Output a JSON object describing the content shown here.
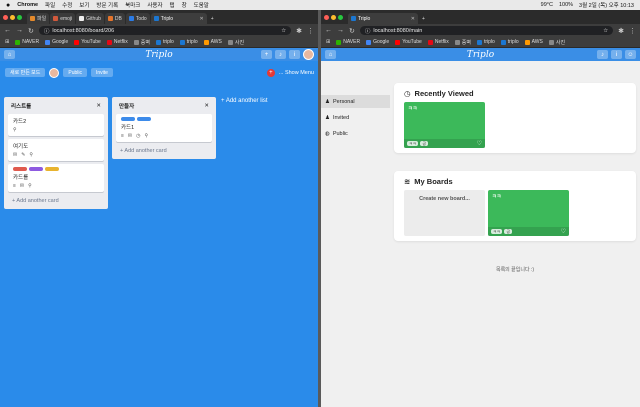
{
  "menubar": {
    "app": "Chrome",
    "items": [
      "파일",
      "수정",
      "보기",
      "방문 기록",
      "북마크",
      "사용자",
      "탭",
      "창",
      "도움말"
    ],
    "right": [
      "99°C",
      "100%",
      "3월 2일 (목) 오후 10:13"
    ]
  },
  "left": {
    "tabs": [
      "파일",
      "emoji",
      "Github",
      "DB",
      "Todo",
      "Triplo"
    ],
    "active_tab": "Triplo",
    "url": "localhost:8080/board/206",
    "bookmarks": [
      "NAVER",
      "Google",
      "YouTube",
      "Netflix",
      "증벽",
      "triplo",
      "triplo",
      "AWS",
      "사진"
    ],
    "app_logo": "Triplo",
    "board": {
      "title_chip": "새로 만든 보드",
      "public_chip": "Public",
      "invite_chip": "Invite",
      "badge": "+",
      "show_menu": "... Show Menu",
      "add_list": "+ Add another list",
      "lists": [
        {
          "title": "리스트를",
          "close": "✕",
          "cards": [
            {
              "title": "카드2",
              "labels": [],
              "badges": [
                "⚲"
              ]
            },
            {
              "title": "여기도",
              "labels": [],
              "badges": [
                "✉",
                "✎",
                "⚲"
              ]
            },
            {
              "title": "카드를",
              "labels": [
                "#e05a4e",
                "#8e5ae0",
                "#e8b32e"
              ],
              "badges": [
                "≡",
                "✉",
                "⚲"
              ]
            }
          ],
          "add_card": "+ Add another card"
        },
        {
          "title": "만들자",
          "close": "✕",
          "cards": [
            {
              "title": "카드1",
              "labels": [
                "#3d8bea",
                "#3d8bea"
              ],
              "badges": [
                "≡",
                "✉",
                "◷",
                "⚲"
              ]
            }
          ],
          "add_card": "+ Add another card"
        }
      ]
    }
  },
  "right": {
    "tab": "Triplo",
    "url": "localhost:8080/main",
    "bookmarks": [
      "NAVER",
      "Google",
      "YouTube",
      "Netflix",
      "증벽",
      "triplo",
      "triplo",
      "AWS",
      "사진"
    ],
    "app_logo": "Triplo",
    "sidebar": [
      "Personal",
      "Invited",
      "Public"
    ],
    "recently_viewed": {
      "title": "Recently Viewed",
      "tiles": [
        {
          "name": "ㅋㅋ",
          "pills": [
            "ㅋㅋ",
            "공"
          ]
        }
      ]
    },
    "my_boards": {
      "title": "My Boards",
      "create_label": "Create new board...",
      "tiles": [
        {
          "name": "ㅋㅋ",
          "pills": [
            "ㅋㅋ",
            "공"
          ]
        }
      ]
    },
    "end_text": "목록의 끝입니다 :)"
  }
}
